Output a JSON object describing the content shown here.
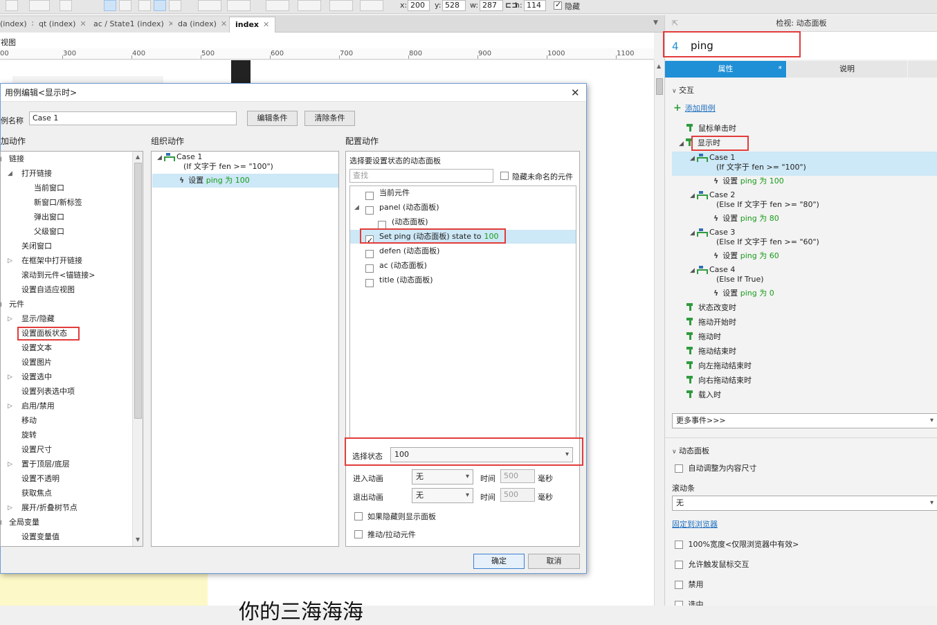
{
  "toolbar": {
    "x_label": "x:",
    "x_value": "200",
    "y_label": "y:",
    "y_value": "528",
    "w_label": "w:",
    "w_value": "287",
    "h_label": "h:",
    "h_value": "114",
    "hidden_label": "隐藏",
    "hidden_checked": true
  },
  "tabs": [
    {
      "label": "(index)"
    },
    {
      "label": "qt (index)"
    },
    {
      "label": "ac / State1 (index)"
    },
    {
      "label": "da (index)"
    },
    {
      "label": "index",
      "active": true
    }
  ],
  "canvas": {
    "view_label": "首视图",
    "ruler_ticks": [
      "00",
      "300",
      "400",
      "500",
      "600",
      "700",
      "800",
      "900",
      "1000",
      "1100"
    ],
    "bottom_text": "你的三海海海"
  },
  "right_panel": {
    "title": "检视: 动态面板",
    "widget_count": "4",
    "widget_name": "ping",
    "tab_properties": "属性",
    "tab_notes": "说明",
    "interaction_header": "交互",
    "add_case": "添加用例",
    "events": {
      "click": "鼠标单击时",
      "show": "显示时",
      "state_change": "状态改变时",
      "drag_start": "拖动开始时",
      "drag": "拖动时",
      "drag_end": "拖动结束时",
      "swipe_left": "向左拖动结束时",
      "swipe_right": "向右拖动结束时",
      "load": "载入时"
    },
    "cases": [
      {
        "name": "Case 1",
        "cond": "(If 文字于 fen >= \"100\")",
        "action_pre": "设置",
        "action_val": "ping 为 100"
      },
      {
        "name": "Case 2",
        "cond": "(Else If 文字于 fen >= \"80\")",
        "action_pre": "设置",
        "action_val": "ping 为 80"
      },
      {
        "name": "Case 3",
        "cond": "(Else If 文字于 fen >= \"60\")",
        "action_pre": "设置",
        "action_val": "ping 为 60"
      },
      {
        "name": "Case 4",
        "cond": "(Else If True)",
        "action_pre": "设置",
        "action_val": "ping 为 0"
      }
    ],
    "more_events": "更多事件>>>",
    "dp_header": "动态面板",
    "auto_fit": "自动调整为内容尺寸",
    "scrollbar_label": "滚动条",
    "scrollbar_value": "无",
    "pin_browser": "固定到浏览器",
    "width100": "100%宽度<仅限浏览器中有效>",
    "allow_mouse": "允许触发鼠标交互",
    "disabled": "禁用",
    "selected": "选中"
  },
  "dialog": {
    "title": "用例编辑<显示时>",
    "case_name_label": "例名称",
    "case_name_value": "Case 1",
    "edit_cond": "编辑条件",
    "clear_cond": "清除条件",
    "add_action_header": "加动作",
    "organize_header": "组织动作",
    "config_header": "配置动作",
    "actions_tree": [
      {
        "label": "链接",
        "level": 0,
        "expand": "open"
      },
      {
        "label": "打开链接",
        "level": 1,
        "expand": "open"
      },
      {
        "label": "当前窗口",
        "level": 2
      },
      {
        "label": "新窗口/新标签",
        "level": 2
      },
      {
        "label": "弹出窗口",
        "level": 2
      },
      {
        "label": "父级窗口",
        "level": 2
      },
      {
        "label": "关闭窗口",
        "level": 1
      },
      {
        "label": "在框架中打开链接",
        "level": 1,
        "expand": "closed"
      },
      {
        "label": "滚动到元件<锚链接>",
        "level": 1
      },
      {
        "label": "设置自适应视图",
        "level": 1
      },
      {
        "label": "元件",
        "level": 0,
        "expand": "open"
      },
      {
        "label": "显示/隐藏",
        "level": 1,
        "expand": "closed"
      },
      {
        "label": "设置面板状态",
        "level": 1,
        "highlight": true
      },
      {
        "label": "设置文本",
        "level": 1
      },
      {
        "label": "设置图片",
        "level": 1
      },
      {
        "label": "设置选中",
        "level": 1,
        "expand": "closed"
      },
      {
        "label": "设置列表选中项",
        "level": 1
      },
      {
        "label": "启用/禁用",
        "level": 1,
        "expand": "closed"
      },
      {
        "label": "移动",
        "level": 1
      },
      {
        "label": "旋转",
        "level": 1
      },
      {
        "label": "设置尺寸",
        "level": 1
      },
      {
        "label": "置于顶层/底层",
        "level": 1,
        "expand": "closed"
      },
      {
        "label": "设置不透明",
        "level": 1
      },
      {
        "label": "获取焦点",
        "level": 1
      },
      {
        "label": "展开/折叠树节点",
        "level": 1,
        "expand": "closed"
      },
      {
        "label": "全局变量",
        "level": 0,
        "expand": "open"
      },
      {
        "label": "设置变量值",
        "level": 1
      }
    ],
    "organize": {
      "case_name": "Case 1",
      "case_cond": "(If 文字于 fen >= \"100\")",
      "action_pre": "设置",
      "action_val": "ping 为 100"
    },
    "config": {
      "select_panel_label": "选择要设置状态的动态面板",
      "search_placeholder": "查找",
      "hide_unnamed": "隐藏未命名的元件",
      "panels": [
        {
          "label": "当前元件",
          "level": 0
        },
        {
          "label": "panel (动态面板)",
          "level": 0,
          "expand": "open"
        },
        {
          "label": "(动态面板)",
          "level": 1
        },
        {
          "label": "Set ping (动态面板) state to",
          "value": "100",
          "level": 0,
          "checked": true,
          "selected": true
        },
        {
          "label": "defen (动态面板)",
          "level": 0
        },
        {
          "label": "ac (动态面板)",
          "level": 0
        },
        {
          "label": "title (动态面板)",
          "level": 0
        }
      ],
      "select_state_label": "选择状态",
      "select_state_value": "100",
      "enter_anim_label": "进入动画",
      "enter_anim_value": "无",
      "exit_anim_label": "退出动画",
      "exit_anim_value": "无",
      "time_label": "时间",
      "time_value": "500",
      "ms_label": "毫秒",
      "show_if_hidden": "如果隐藏则显示面板",
      "push_widgets": "推动/拉动元件"
    },
    "ok": "确定",
    "cancel": "取消"
  },
  "colors": {
    "accent": "#1f8fd6",
    "highlight_red": "#e23b3b",
    "value_green": "#189a18"
  }
}
